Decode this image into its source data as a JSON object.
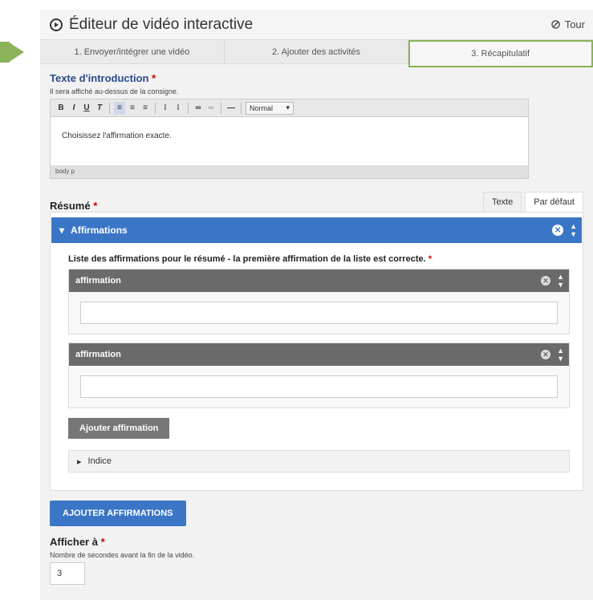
{
  "header": {
    "title": "Éditeur de vidéo interactive",
    "tour_label": "Tour"
  },
  "tabs": [
    {
      "label": "1. Envoyer/intégrer une vidéo"
    },
    {
      "label": "2. Ajouter des activités"
    },
    {
      "label": "3. Récapitulatif"
    }
  ],
  "intro": {
    "label": "Texte d'introduction",
    "required_mark": "*",
    "description": "Il sera affiché au-dessus de la consigne.",
    "format_select": "Normal",
    "body_text": "Choisissez l'affirmation exacte.",
    "path": "body  p"
  },
  "summary": {
    "label": "Résumé",
    "required_mark": "*",
    "mode_tabs": [
      "Texte",
      "Par défaut"
    ],
    "group_title": "Affirmations",
    "list_label": "Liste des affirmations pour le résumé - la première affirmation de la liste est correcte.",
    "items": [
      {
        "title": "affirmation",
        "value": ""
      },
      {
        "title": "affirmation",
        "value": ""
      }
    ],
    "add_button": "Ajouter affirmation",
    "hint_label": "Indice",
    "add_group_button": "AJOUTER AFFIRMATIONS"
  },
  "show_at": {
    "label": "Afficher à",
    "required_mark": "*",
    "description": "Nombre de secondes avant la fin de la vidéo.",
    "value": "3"
  },
  "colors": {
    "accent_blue": "#3b76c6",
    "highlight_green": "#8bb35a",
    "item_header_gray": "#6a6a6a"
  }
}
